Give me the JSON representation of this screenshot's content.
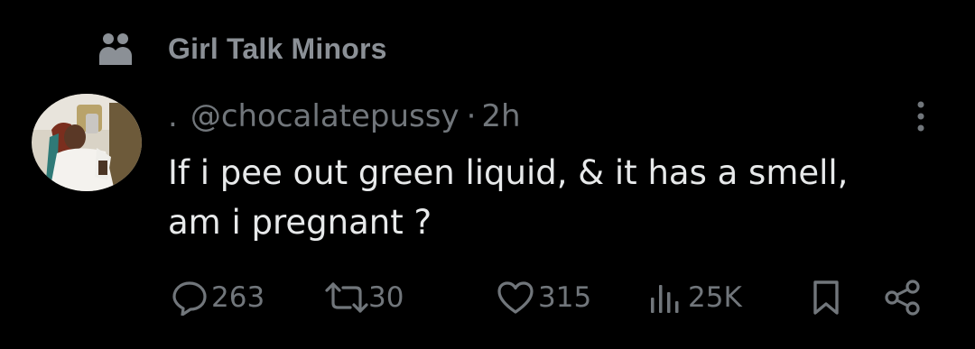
{
  "community": {
    "icon": "community-people-icon",
    "name": "Girl Talk Minors"
  },
  "tweet": {
    "display_name": ".",
    "handle": "@chocalatepussy",
    "separator": "·",
    "time": "2h",
    "text_lines": [
      "If i pee out green liquid, & it has a smell,",
      "am i pregnant ?"
    ]
  },
  "actions": {
    "replies": "263",
    "reposts": "30",
    "likes": "315",
    "views": "25K"
  },
  "colors": {
    "background": "#000000",
    "text_primary": "#e7e9ea",
    "text_secondary": "#71767b",
    "community_label": "#8b9096"
  }
}
